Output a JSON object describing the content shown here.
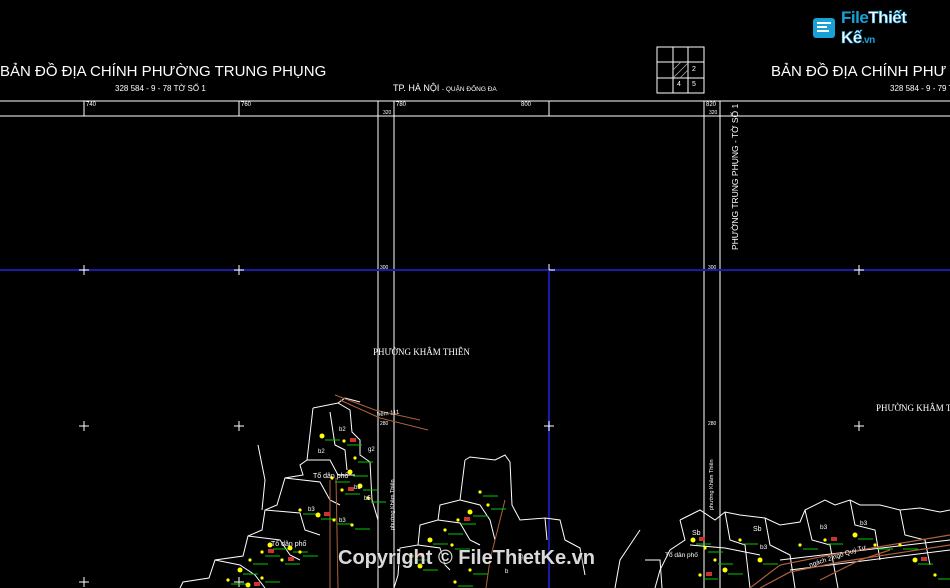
{
  "header": {
    "title_left": "BẢN ĐỒ ĐỊA CHÍNH PHƯỜNG TRUNG PHỤNG",
    "subtitle_left": "328 584 - 9 - 78 TỜ SỐ 1",
    "city": "TP. HÀ NỘI",
    "district": "- QUẬN ĐỐNG ĐA",
    "title_right": "BẢN ĐỒ ĐỊA CHÍNH PHƯ",
    "subtitle_right": "328 584 - 9 - 79 T"
  },
  "index_grid": {
    "cells": [
      "",
      "",
      "",
      "",
      "2",
      "",
      "4",
      "5",
      ""
    ]
  },
  "axis": {
    "top_ticks": [
      "740",
      "760",
      "780",
      "800",
      "820"
    ],
    "mini_ticks": [
      "320",
      "320"
    ],
    "side_ticks": [
      "300",
      "300",
      "280",
      "280"
    ]
  },
  "labels": {
    "vertical_sheet_label": "PHƯỜNG TRUNG PHỤNG - TỜ SỐ 1",
    "ward_khamthien_center": "PHƯỜNG KHÂM THIÊN",
    "ward_khamthien_right": "PHƯỜNG KHÂM TH",
    "alley_label": "hẻm 111",
    "street_vertical_1": "phường Khâm Thiên",
    "street_vertical_2": "phường Khâm Thiên",
    "to_dan_pho_1": "Tổ dân phố",
    "to_dan_pho_2": "Tổ dân phố",
    "to_dan_pho_3": "Tổ dân phố",
    "lane_right": "ngách 2 ngõ Quý Tư"
  },
  "parcels": [
    "b2",
    "b2",
    "g2",
    "b3",
    "b5",
    "b3",
    "b3",
    "b",
    "Sb",
    "b3",
    "b3",
    "b3",
    "Sb",
    "g"
  ],
  "watermark": {
    "logo_text_a": "File",
    "logo_text_b": "Thiết Kế",
    "logo_suffix": ".vn",
    "copyright": "Copyright © FileThietKe.vn"
  },
  "colors": {
    "background": "#000000",
    "blue_grid": "#1a1aa8",
    "white_line": "#ffffff",
    "yellow": "#ffff00",
    "green": "#00c800",
    "red": "#d03030",
    "brown": "#b0603a",
    "logo_blue": "#1aa0d8"
  }
}
